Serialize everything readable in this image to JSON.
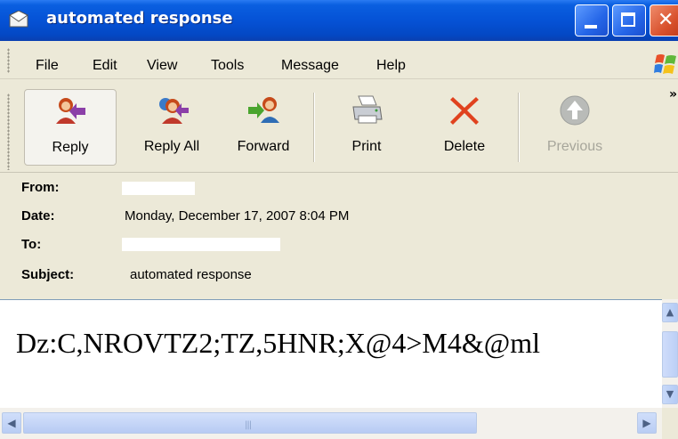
{
  "window": {
    "title": "automated response"
  },
  "menu": {
    "items": [
      "File",
      "Edit",
      "View",
      "Tools",
      "Message",
      "Help"
    ]
  },
  "toolbar": {
    "reply": "Reply",
    "reply_all": "Reply All",
    "forward": "Forward",
    "print": "Print",
    "delete": "Delete",
    "previous": "Previous"
  },
  "header": {
    "from_label": "From:",
    "date_label": "Date:",
    "to_label": "To:",
    "subject_label": "Subject:",
    "date_value": "Monday, December 17, 2007 8:04 PM",
    "subject_value": "automated response"
  },
  "message": {
    "body": "Dz:C,NROVTZ2;TZ,5HNR;X@4>M4&@ml"
  },
  "colors": {
    "titlebar": "#0552d6",
    "window_bg": "#ece9d8",
    "delete_red": "#e0421e"
  }
}
